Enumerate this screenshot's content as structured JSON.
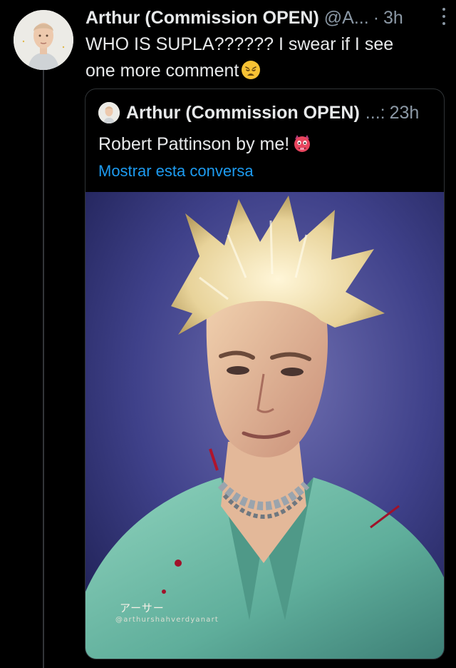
{
  "tweet": {
    "author_name": "Arthur (Commission OPEN)",
    "handle": "@A...",
    "separator": "·",
    "time": "3h",
    "text": "WHO IS SUPLA?????? I swear if I see one more comment",
    "emoji_icon": "weary-face-icon"
  },
  "quoted_tweet": {
    "author_name": "Arthur (Commission OPEN)",
    "handle_truncated": "...:",
    "time": "23h",
    "text": "Robert Pattinson by me!",
    "emoji_icon": "hot-face-demon-icon",
    "show_thread_link": "Mostrar esta conversa",
    "image": {
      "signature": "アーサー",
      "watermark": "@arthurshahverdyanart"
    }
  },
  "colors": {
    "background": "#000000",
    "text_primary": "#e7e9ea",
    "text_secondary": "#8b98a5",
    "link": "#1d9bf0",
    "border": "#2f3336"
  }
}
